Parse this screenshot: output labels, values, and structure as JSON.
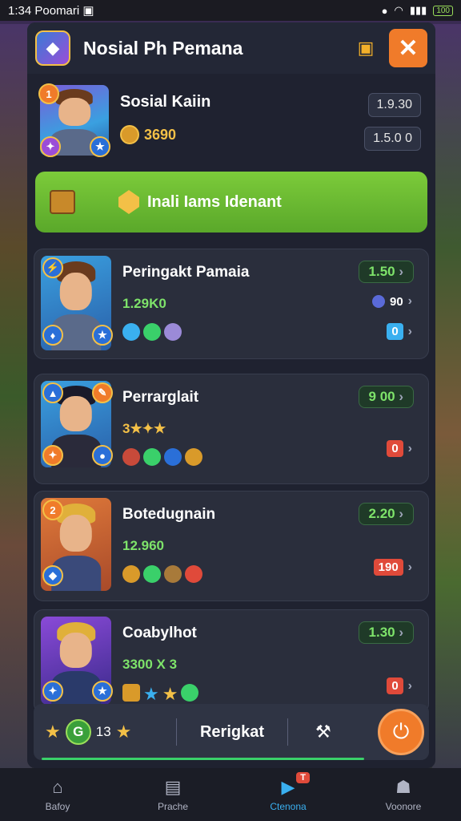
{
  "status": {
    "time": "1:34",
    "carrier": "Poomari",
    "battery": "100"
  },
  "header": {
    "title": "Nosial Ph Pemana",
    "icon_left": "app-logo-icon",
    "icon_right": "chest-icon",
    "close_label": "✕"
  },
  "profile": {
    "name": "Sosial Kaiin",
    "coins": "3690",
    "stat_top": "1.9.30",
    "stat_bottom": "1.5.0 0",
    "badge": "1"
  },
  "banner": {
    "text": "Inali Iams Idenant"
  },
  "cards": [
    {
      "name": "Peringakt Pamaia",
      "stat": "1.29K0",
      "score": "1.50",
      "side_value": "90",
      "side_box": "0"
    },
    {
      "name": "Perrarglait",
      "stat": "3★✦★",
      "score": "9 00",
      "side_box": "0"
    },
    {
      "name": "Botedugnain",
      "stat": "12.960",
      "score": "2.20",
      "side_box": "190",
      "badge": "2"
    },
    {
      "name": "Coabylhot",
      "stat": "3300 X 3",
      "score": "1.30",
      "side_box": "0"
    }
  ],
  "actionbar": {
    "left_count": "13",
    "badge_letter": "G",
    "label": "Rerigkat",
    "progress": 0.85
  },
  "nav": [
    {
      "label": "Bafoy",
      "icon": "home-icon"
    },
    {
      "label": "Prache",
      "icon": "chat-icon"
    },
    {
      "label": "Ctenona",
      "icon": "play-icon",
      "badge": "T",
      "active": true
    },
    {
      "label": "Voonore",
      "icon": "profile-icon"
    }
  ]
}
